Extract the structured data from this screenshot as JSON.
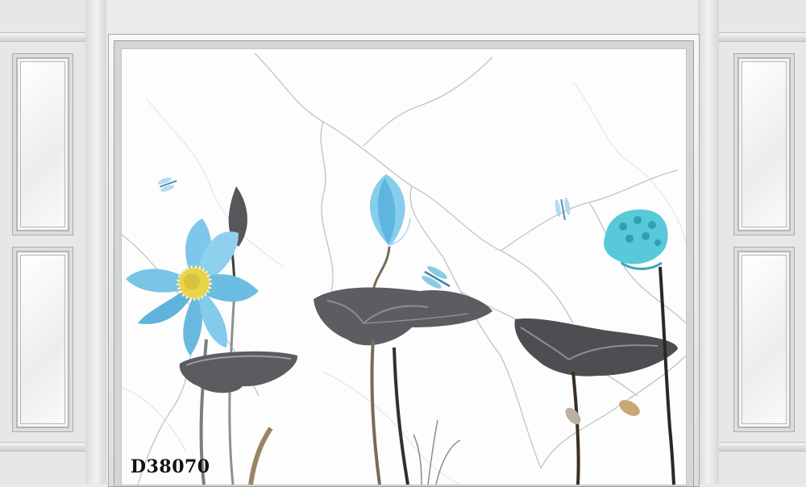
{
  "product": {
    "code": "D38070"
  },
  "colors": {
    "wall": "#e6e7e8",
    "marble": "#fdfdfd",
    "vein": "#b9bcbf",
    "lotus_blue": "#6fc3e6",
    "leaf_ink": "#4a4c4f",
    "seed_pod": "#54c7d8"
  }
}
